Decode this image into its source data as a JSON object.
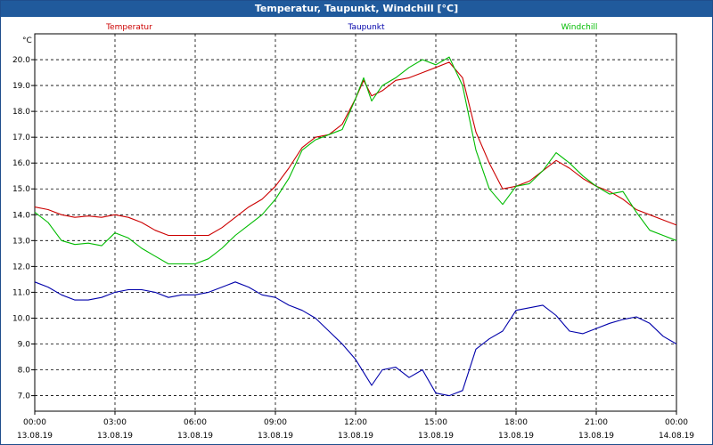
{
  "window": {
    "title": "Temperatur, Taupunkt, Windchill [°C]"
  },
  "chart_data": {
    "type": "line",
    "title": "Temperatur, Taupunkt, Windchill [°C]",
    "ylabel": "°C",
    "xlabel": "",
    "ylim": [
      6.4,
      21.0
    ],
    "xlim_hours": [
      0,
      24
    ],
    "grid": true,
    "y_ticks": [
      7.0,
      8.0,
      9.0,
      10.0,
      11.0,
      12.0,
      13.0,
      14.0,
      15.0,
      16.0,
      17.0,
      18.0,
      19.0,
      20.0
    ],
    "x_ticks": [
      {
        "hour": 0,
        "time": "00:00",
        "date": "13.08.19"
      },
      {
        "hour": 3,
        "time": "03:00",
        "date": "13.08.19"
      },
      {
        "hour": 6,
        "time": "06:00",
        "date": "13.08.19"
      },
      {
        "hour": 9,
        "time": "09:00",
        "date": "13.08.19"
      },
      {
        "hour": 12,
        "time": "12:00",
        "date": "13.08.19"
      },
      {
        "hour": 15,
        "time": "15:00",
        "date": "13.08.19"
      },
      {
        "hour": 18,
        "time": "18:00",
        "date": "13.08.19"
      },
      {
        "hour": 21,
        "time": "21:00",
        "date": "13.08.19"
      },
      {
        "hour": 24,
        "time": "00:00",
        "date": "14.08.19"
      }
    ],
    "series": [
      {
        "name": "Temperatur",
        "color": "#cc0000",
        "points": [
          [
            0.0,
            14.3
          ],
          [
            0.5,
            14.2
          ],
          [
            1.0,
            14.0
          ],
          [
            1.5,
            13.9
          ],
          [
            2.0,
            13.95
          ],
          [
            2.5,
            13.9
          ],
          [
            3.0,
            14.0
          ],
          [
            3.5,
            13.9
          ],
          [
            4.0,
            13.7
          ],
          [
            4.5,
            13.4
          ],
          [
            5.0,
            13.2
          ],
          [
            5.5,
            13.2
          ],
          [
            6.0,
            13.2
          ],
          [
            6.5,
            13.2
          ],
          [
            7.0,
            13.5
          ],
          [
            7.5,
            13.9
          ],
          [
            8.0,
            14.3
          ],
          [
            8.5,
            14.6
          ],
          [
            9.0,
            15.1
          ],
          [
            9.5,
            15.8
          ],
          [
            10.0,
            16.6
          ],
          [
            10.5,
            17.0
          ],
          [
            11.0,
            17.1
          ],
          [
            11.5,
            17.5
          ],
          [
            12.0,
            18.5
          ],
          [
            12.3,
            19.2
          ],
          [
            12.6,
            18.6
          ],
          [
            13.0,
            18.8
          ],
          [
            13.5,
            19.2
          ],
          [
            14.0,
            19.3
          ],
          [
            14.5,
            19.5
          ],
          [
            15.0,
            19.7
          ],
          [
            15.5,
            19.9
          ],
          [
            16.0,
            19.3
          ],
          [
            16.5,
            17.2
          ],
          [
            17.0,
            16.0
          ],
          [
            17.5,
            15.0
          ],
          [
            18.0,
            15.1
          ],
          [
            18.5,
            15.3
          ],
          [
            19.0,
            15.7
          ],
          [
            19.5,
            16.1
          ],
          [
            20.0,
            15.8
          ],
          [
            20.5,
            15.4
          ],
          [
            21.0,
            15.1
          ],
          [
            21.5,
            14.9
          ],
          [
            22.0,
            14.6
          ],
          [
            22.5,
            14.2
          ],
          [
            23.0,
            14.0
          ],
          [
            23.5,
            13.8
          ],
          [
            24.0,
            13.6
          ]
        ]
      },
      {
        "name": "Taupunkt",
        "color": "#0000aa",
        "points": [
          [
            0.0,
            11.4
          ],
          [
            0.5,
            11.2
          ],
          [
            1.0,
            10.9
          ],
          [
            1.5,
            10.7
          ],
          [
            2.0,
            10.7
          ],
          [
            2.5,
            10.8
          ],
          [
            3.0,
            11.0
          ],
          [
            3.5,
            11.1
          ],
          [
            4.0,
            11.1
          ],
          [
            4.5,
            11.0
          ],
          [
            5.0,
            10.8
          ],
          [
            5.5,
            10.9
          ],
          [
            6.0,
            10.9
          ],
          [
            6.5,
            11.0
          ],
          [
            7.0,
            11.2
          ],
          [
            7.5,
            11.4
          ],
          [
            8.0,
            11.2
          ],
          [
            8.5,
            10.9
          ],
          [
            9.0,
            10.8
          ],
          [
            9.5,
            10.5
          ],
          [
            10.0,
            10.3
          ],
          [
            10.5,
            10.0
          ],
          [
            11.0,
            9.5
          ],
          [
            11.5,
            9.0
          ],
          [
            12.0,
            8.4
          ],
          [
            12.3,
            7.9
          ],
          [
            12.6,
            7.4
          ],
          [
            13.0,
            8.0
          ],
          [
            13.5,
            8.1
          ],
          [
            14.0,
            7.7
          ],
          [
            14.5,
            8.0
          ],
          [
            15.0,
            7.1
          ],
          [
            15.5,
            7.0
          ],
          [
            16.0,
            7.2
          ],
          [
            16.5,
            8.8
          ],
          [
            17.0,
            9.2
          ],
          [
            17.5,
            9.5
          ],
          [
            18.0,
            10.3
          ],
          [
            18.5,
            10.4
          ],
          [
            19.0,
            10.5
          ],
          [
            19.5,
            10.1
          ],
          [
            20.0,
            9.5
          ],
          [
            20.5,
            9.4
          ],
          [
            21.0,
            9.6
          ],
          [
            21.5,
            9.8
          ],
          [
            22.0,
            9.95
          ],
          [
            22.5,
            10.05
          ],
          [
            23.0,
            9.8
          ],
          [
            23.5,
            9.3
          ],
          [
            24.0,
            9.0
          ]
        ]
      },
      {
        "name": "Windchill",
        "color": "#00bb00",
        "points": [
          [
            0.0,
            14.1
          ],
          [
            0.5,
            13.7
          ],
          [
            1.0,
            13.0
          ],
          [
            1.5,
            12.85
          ],
          [
            2.0,
            12.9
          ],
          [
            2.5,
            12.8
          ],
          [
            3.0,
            13.3
          ],
          [
            3.5,
            13.1
          ],
          [
            4.0,
            12.7
          ],
          [
            4.5,
            12.4
          ],
          [
            5.0,
            12.1
          ],
          [
            5.5,
            12.1
          ],
          [
            6.0,
            12.1
          ],
          [
            6.5,
            12.3
          ],
          [
            7.0,
            12.7
          ],
          [
            7.5,
            13.2
          ],
          [
            8.0,
            13.6
          ],
          [
            8.5,
            14.0
          ],
          [
            9.0,
            14.6
          ],
          [
            9.5,
            15.4
          ],
          [
            10.0,
            16.5
          ],
          [
            10.5,
            16.9
          ],
          [
            11.0,
            17.1
          ],
          [
            11.5,
            17.3
          ],
          [
            12.0,
            18.5
          ],
          [
            12.3,
            19.3
          ],
          [
            12.6,
            18.4
          ],
          [
            13.0,
            19.0
          ],
          [
            13.5,
            19.3
          ],
          [
            14.0,
            19.7
          ],
          [
            14.5,
            20.0
          ],
          [
            15.0,
            19.8
          ],
          [
            15.5,
            20.1
          ],
          [
            16.0,
            19.0
          ],
          [
            16.5,
            16.5
          ],
          [
            17.0,
            15.0
          ],
          [
            17.5,
            14.4
          ],
          [
            18.0,
            15.1
          ],
          [
            18.5,
            15.2
          ],
          [
            19.0,
            15.7
          ],
          [
            19.5,
            16.4
          ],
          [
            20.0,
            16.0
          ],
          [
            20.5,
            15.5
          ],
          [
            21.0,
            15.1
          ],
          [
            21.5,
            14.8
          ],
          [
            22.0,
            14.9
          ],
          [
            22.5,
            14.1
          ],
          [
            23.0,
            13.4
          ],
          [
            23.5,
            13.2
          ],
          [
            24.0,
            13.0
          ]
        ]
      }
    ]
  }
}
